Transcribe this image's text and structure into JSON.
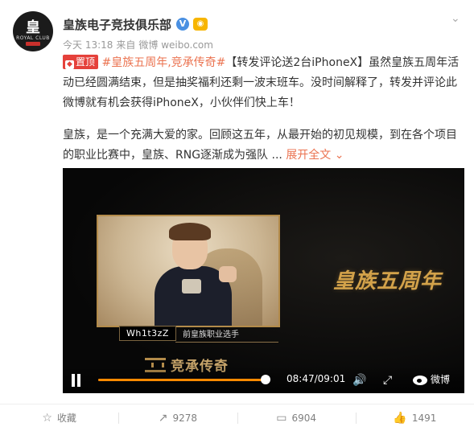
{
  "post": {
    "user_name": "皇族电子竞技俱乐部",
    "time": "今天 13:18",
    "source_prefix": "来自",
    "source": "微博 weibo.com",
    "avatar_text": "皇",
    "avatar_subtext": "ROYAL CLUB",
    "top_badge": "置顶",
    "hashtag": "#皇族五周年,竞承传奇#",
    "text_1": "【转发评论送2台iPhoneX】虽然皇族五周年活动已经圆满结束，但是抽奖福利还剩一波末班车。没时间解释了，转发并评论此微博就有机会获得iPhoneX，小伙伴们快上车！",
    "text_2": "皇族，是一个充满大爱的家。回顾这五年，从最开始的初见规模，到在各个项目的职业比赛中，皇族、RNG逐渐成为强队 ...",
    "expand_label": "展开全文",
    "expand_icon": "⌄"
  },
  "video": {
    "player_name": "Wh1t3zZ",
    "player_desc": "前皇族职业选手",
    "calligraphy": "皇族五周年",
    "series_title": "竞承传奇",
    "current_time": "08:47",
    "duration": "09:01",
    "time_display": "08:47/09:01",
    "progress_fraction": 0.974,
    "brand": "微博"
  },
  "actions": [
    {
      "icon": "☆",
      "label": "收藏"
    },
    {
      "icon": "↗",
      "label": "9278"
    },
    {
      "icon": "▭",
      "label": "6904"
    },
    {
      "icon": "👍",
      "label": "1491"
    }
  ],
  "colors": {
    "accent": "#eb7350",
    "badge_red": "#e5413b",
    "progress": "#ff8a00",
    "gold": "#d3a24a"
  }
}
